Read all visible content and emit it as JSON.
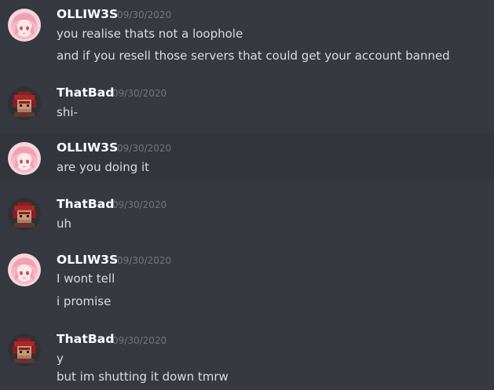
{
  "colors": {
    "background": "#36393f",
    "hover_background": "#32353b",
    "username": "#ffffff",
    "timestamp": "#72767d",
    "message_text": "#dcddde"
  },
  "messages": [
    {
      "author": "OLLIW3S",
      "avatar_icon": "anime-girl-avatar-icon",
      "timestamp": "09/30/2020",
      "lines": [
        "you realise thats not a loophole",
        "and if you resell those servers that could get your account banned"
      ]
    },
    {
      "author": "ThatBad",
      "avatar_icon": "pixel-character-avatar-icon",
      "timestamp": "09/30/2020",
      "lines": [
        "shi-"
      ]
    },
    {
      "author": "OLLIW3S",
      "avatar_icon": "anime-girl-avatar-icon",
      "timestamp": "09/30/2020",
      "lines": [
        "are you doing it"
      ],
      "hovered": true
    },
    {
      "author": "ThatBad",
      "avatar_icon": "pixel-character-avatar-icon",
      "timestamp": "09/30/2020",
      "lines": [
        "uh"
      ]
    },
    {
      "author": "OLLIW3S",
      "avatar_icon": "anime-girl-avatar-icon",
      "timestamp": "09/30/2020",
      "lines": [
        "I wont tell",
        "i promise"
      ]
    },
    {
      "author": "ThatBad",
      "avatar_icon": "pixel-character-avatar-icon",
      "timestamp": "09/30/2020",
      "lines": [
        "y",
        "but im shutting it down tmrw"
      ]
    }
  ]
}
